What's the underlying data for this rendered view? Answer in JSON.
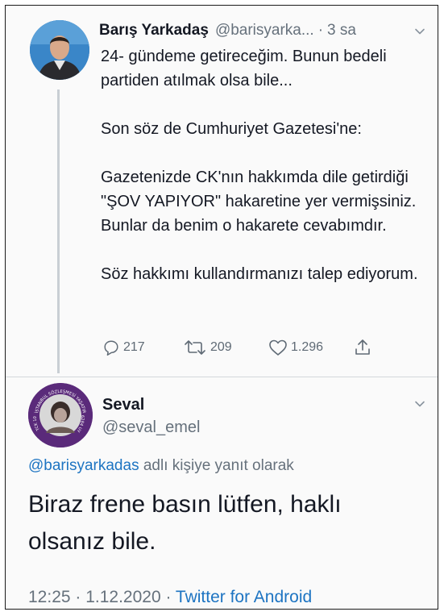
{
  "tweet1": {
    "display_name": "Barış Yarkadaş",
    "handle": "@barisyarka...",
    "separator": "·",
    "time_ago": "3 sa",
    "paragraphs": [
      "24- gündeme getireceğim. Bunun bedeli partiden atılmak olsa bile...",
      "Son söz de Cumhuriyet Gazetesi'ne:",
      "Gazetenizde CK'nın hakkımda dile getirdiği \"ŞOV YAPIYOR\" hakaretine yer vermişsiniz. Bunlar da benim o hakarete cevabımdır.",
      "Söz hakkımı kullandırmanızı talep ediyorum."
    ],
    "replies": "217",
    "retweets": "209",
    "likes": "1.296"
  },
  "tweet2": {
    "display_name": "Seval",
    "handle": "@seval_emel",
    "avatar_ring_text_top": "İSTANBUL SÖZLEŞMESİ YAŞATIR",
    "avatar_ring_text_left": "TCK 103",
    "avatar_ring_text_right": "6284 UYGULA",
    "reply_to_mention": "@barisyarkadas",
    "reply_to_suffix": " adlı kişiye yanıt olarak",
    "text": "Biraz frene basın lütfen, haklı olsanız bile.",
    "timestamp": "12:25 · 1.12.2020 · ",
    "source": "Twitter for Android"
  },
  "colors": {
    "link": "#1d74c2",
    "muted": "#66717c",
    "text": "#141823",
    "avatar_ring": "#5a2a7a"
  },
  "icons": [
    "chevron-down-icon",
    "reply-icon",
    "retweet-icon",
    "like-icon",
    "share-icon"
  ]
}
